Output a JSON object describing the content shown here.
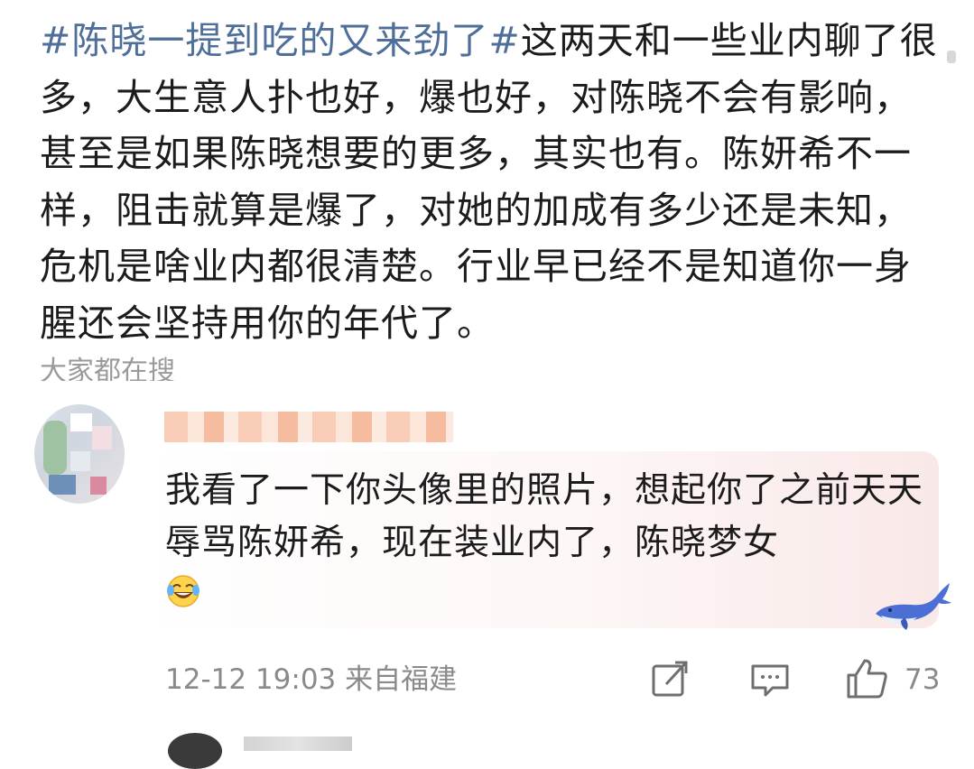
{
  "post": {
    "hashtag": "#陈晓一提到吃的又来劲了#",
    "text": "这两天和一些业内聊了很多，大生意人扑也好，爆也好，对陈晓不会有影响，甚至是如果陈晓想要的更多，其实也有。陈妍希不一样，阻击就算是爆了，对她的加成有多少还是未知，危机是啥业内都很清楚。行业早已经不是知道你一身腥还会坚持用你的年代了。"
  },
  "search_section": {
    "label": "大家都在搜"
  },
  "comment": {
    "text": "我看了一下你头像里的照片，想起你了之前天天辱骂陈妍希，现在装业内了，陈晓梦女",
    "emoji": "laughing-crying-emoji",
    "time": "12-12 19:03",
    "location": "来自福建",
    "like_count": "73"
  },
  "icons": {
    "share": "share-icon",
    "comment": "comment-icon",
    "like": "like-icon",
    "badge": "whale-badge-icon"
  },
  "colors": {
    "hashtag": "#4f6f9a",
    "text": "#1c1c1c",
    "muted": "#8a8a8a"
  }
}
